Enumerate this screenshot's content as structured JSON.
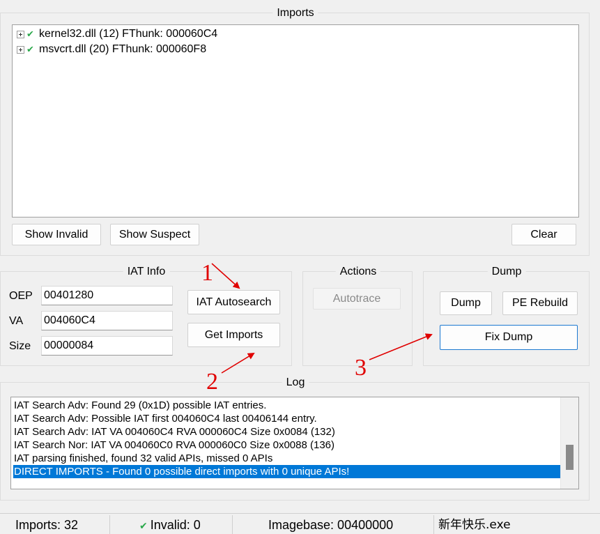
{
  "imports_group": {
    "title": "Imports",
    "tree": [
      {
        "label": "kernel32.dll (12) FThunk: 000060C4"
      },
      {
        "label": "msvcrt.dll (20) FThunk: 000060F8"
      }
    ],
    "buttons": {
      "show_invalid": "Show Invalid",
      "show_suspect": "Show Suspect",
      "clear": "Clear"
    }
  },
  "iat_info": {
    "title": "IAT Info",
    "oep_label": "OEP",
    "oep_value": "00401280",
    "va_label": "VA",
    "va_value": "004060C4",
    "size_label": "Size",
    "size_value": "00000084",
    "autosearch_button": "IAT Autosearch",
    "get_imports_button": "Get Imports"
  },
  "actions": {
    "title": "Actions",
    "autotrace_button": "Autotrace"
  },
  "dump": {
    "title": "Dump",
    "dump_button": "Dump",
    "pe_rebuild_button": "PE Rebuild",
    "fix_dump_button": "Fix Dump"
  },
  "log": {
    "title": "Log",
    "lines": [
      "IAT Search Adv: Found 29 (0x1D) possible IAT entries.",
      "IAT Search Adv: Possible IAT first 004060C4 last 00406144 entry.",
      "IAT Search Adv: IAT VA 004060C4 RVA 000060C4 Size 0x0084 (132)",
      "IAT Search Nor: IAT VA 004060C0 RVA 000060C0 Size 0x0088 (136)",
      "IAT parsing finished, found 32 valid APIs, missed 0 APIs",
      "DIRECT IMPORTS - Found 0 possible direct imports with 0 unique APIs!"
    ],
    "selected_index": 5
  },
  "status_bar": {
    "imports": "Imports: 32",
    "invalid": "Invalid: 0",
    "imagebase": "Imagebase: 00400000",
    "filename": "新年快乐.exe"
  },
  "annotations": {
    "one": "1",
    "two": "2",
    "three": "3",
    "color": "#e00000"
  },
  "icons": {
    "tree_expander": "plus-box-icon",
    "valid": "check-icon"
  }
}
